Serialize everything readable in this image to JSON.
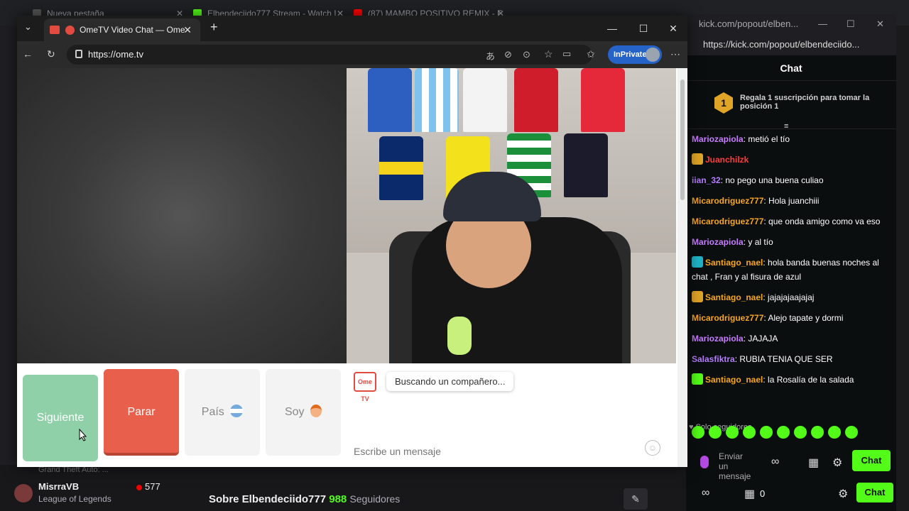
{
  "background_browser": {
    "tabs": [
      {
        "label": "Nueva pestaña"
      },
      {
        "label": "Elbendeciido777 Stream - Watch L"
      },
      {
        "label": "(87) MAMBO POSITIVO REMIX - F"
      }
    ],
    "channel": {
      "name": "MisrraVB",
      "game": "League of Legends",
      "viewers": "577",
      "above_text": "Grand Theft Auto: ..."
    },
    "about": {
      "title": "Sobre Elbendeciido777",
      "followers_count": "988",
      "followers_label": "Seguidores"
    }
  },
  "kick": {
    "title": "kick.com/popout/elben...",
    "url": "https://kick.com/popout/elbendeciido...",
    "header": "Chat",
    "promo": {
      "rank": "1",
      "text": "Regala 1 suscripción para tomar la posición 1"
    },
    "messages": [
      {
        "user": "Mariozapiola",
        "color": "#c77dff",
        "text": "metió el tío"
      },
      {
        "user": "Juanchilzk",
        "color": "#ff3b3b",
        "text": ""
      },
      {
        "user": "iian_32",
        "color": "#b57cff",
        "text": "no pego una buena culiao"
      },
      {
        "user": "Micarodriguez777",
        "color": "#f5a623",
        "text": "Hola juanchiii"
      },
      {
        "user": "Micarodriguez777",
        "color": "#f5a623",
        "text": "que onda amigo como va eso"
      },
      {
        "user": "Mariozapiola",
        "color": "#c77dff",
        "text": "y al tío"
      },
      {
        "user": "Santiago_nael",
        "color": "#f5a623",
        "text": "hola banda buenas noches al chat , Fran y al fisura de azul"
      },
      {
        "user": "Santiago_nael",
        "color": "#f5a623",
        "text": "jajajajaajajaj"
      },
      {
        "user": "Micarodriguez777",
        "color": "#f5a623",
        "text": "Alejo tapate y dormi"
      },
      {
        "user": "Mariozapiola",
        "color": "#c77dff",
        "text": "JAJAJA"
      },
      {
        "user": "Salasfiktra",
        "color": "#b57cff",
        "text": "RUBIA TENIA QUE SER"
      },
      {
        "user": "Santiago_nael",
        "color": "#f5a623",
        "text": "la Rosalía de la salada"
      }
    ],
    "followers_only": "Solo seguidores",
    "send_placeholder": "Enviar un mensaje",
    "chat_button": "Chat",
    "points": "0"
  },
  "edge": {
    "tab_title": "OmeTV Video Chat — Omegl",
    "url": "https://ome.tv",
    "inprivate": "InPrivate"
  },
  "ometv": {
    "buttons": {
      "next": "Siguiente",
      "stop": "Parar",
      "country": "País",
      "gender": "Soy"
    },
    "status": "Buscando un compañero...",
    "logo_text": "Ome TV",
    "message_placeholder": "Escribe un mensaje"
  },
  "colors": {
    "kick_green": "#53fc18",
    "next_green": "#8fd0a8",
    "stop_red": "#e8604c",
    "inprivate_blue": "#2563c9"
  }
}
